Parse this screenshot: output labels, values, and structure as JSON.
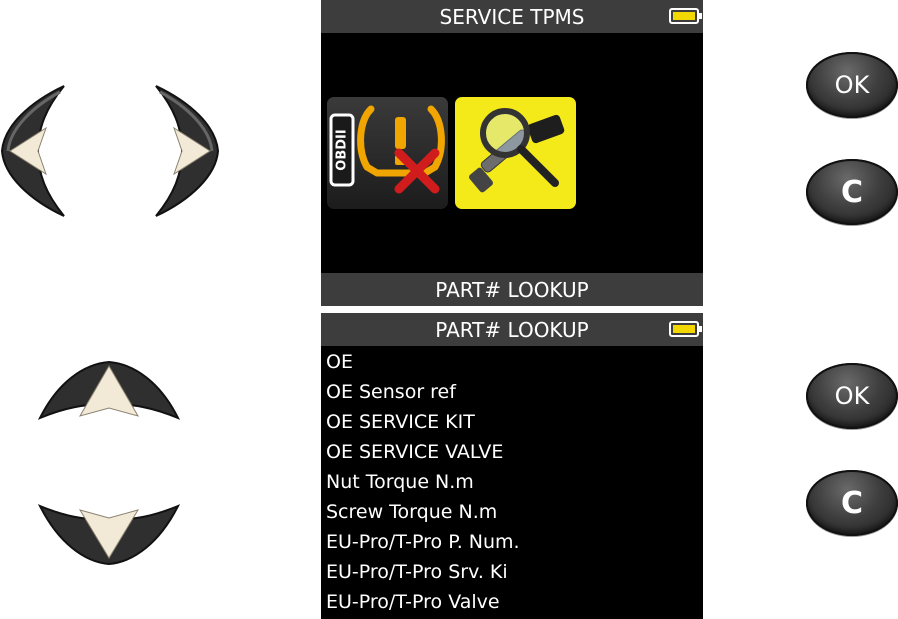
{
  "top_screen": {
    "title": "SERVICE TPMS",
    "footer_label": "PART# LOOKUP",
    "tiles": [
      {
        "icon": "obdii-tpms-warning-disabled-icon",
        "badge": "OBDII"
      },
      {
        "icon": "sensor-magnifier-icon"
      }
    ]
  },
  "bottom_screen": {
    "title": "PART# LOOKUP",
    "items": [
      "OE",
      "OE Sensor ref",
      "OE SERVICE KIT",
      "OE SERVICE VALVE",
      "Nut Torque N.m",
      "Screw Torque N.m",
      "EU-Pro/T-Pro P. Num.",
      "EU-Pro/T-Pro Srv. Ki",
      "EU-Pro/T-Pro Valve"
    ]
  },
  "keys": {
    "ok_label": "OK",
    "c_label": "C"
  },
  "colors": {
    "screen_bg": "#000000",
    "bar_bg": "#3d3d3d",
    "highlight_tile": "#f4ea1a",
    "battery_fill": "#f2d800",
    "warning_orange": "#f0a500",
    "cross_red": "#d01c1c"
  }
}
